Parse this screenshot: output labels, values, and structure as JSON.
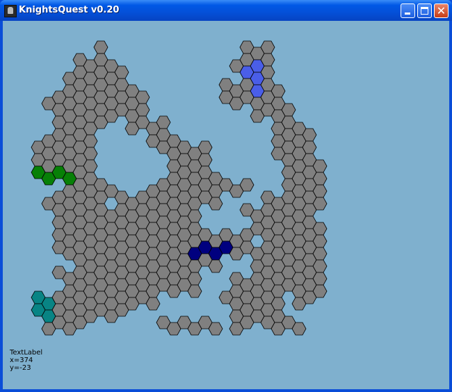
{
  "window": {
    "title": "KnightsQuest v0.20"
  },
  "titlebar_buttons": {
    "minimize": "minimize",
    "maximize": "maximize",
    "close": "✕"
  },
  "colors": {
    "background": "#7fb0ce",
    "hex_default": "#808080",
    "hex_stroke": "#000000",
    "teams": {
      "g": "#078007",
      "b": "#4a5ee8",
      "n": "#00007f",
      "t": "#088484",
      "p": "#7e077e"
    }
  },
  "readout": {
    "label": "TextLabel",
    "x": "x=374",
    "y": "y=-23"
  },
  "map": {
    "cols": 30,
    "rows": 24,
    "legend": ". = empty, # = neutral tile, g/b/n/t/p = team-colored tile",
    "grid": [
      "..............................",
      "........#.............###.....",
      "......####...........##b#.....",
      ".....######...........bb#.....",
      ".....#######........###b##....",
      "...##########.......######....",
      "....#########..........####...",
      "....#####..####..........###..",
      "...#####.....###.........####.",
      "..######......#####......####.",
      "..######.......####.......####",
      "..gggg##.......#####......####",
      ".....#####...##########...####",
      "...######.##########....######",
      "....##############....#######.",
      "....##############.....#######",
      "....###################.######",
      "....#############nnnn#########",
      "......##############...#######",
      "....##############...#.#######",
      ".....#############...#########",
      "..tt##########......######.##.",
      "..tt#######..........#####....",
      "...####.......######.##.####.."
    ]
  }
}
